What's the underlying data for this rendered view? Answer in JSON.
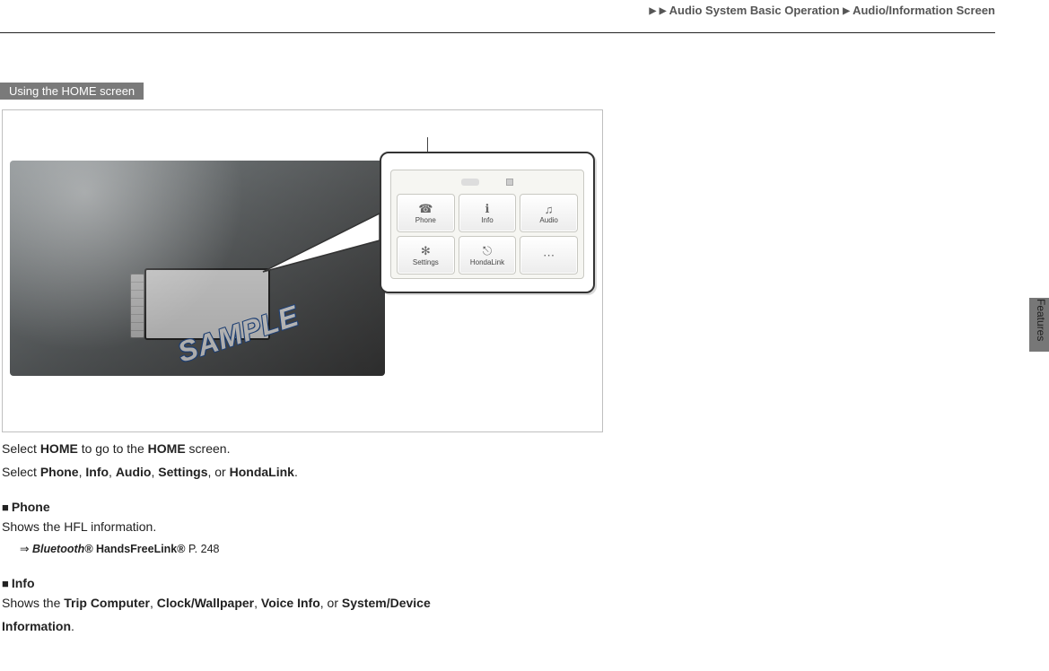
{
  "breadcrumb": {
    "section1": "Audio System Basic Operation",
    "section2": "Audio/Information Screen"
  },
  "section_tab": "Using the HOME screen",
  "side_label": "Features",
  "figure": {
    "sample_stamp": "SAMPLE",
    "tiles": {
      "t1": {
        "label": "Phone"
      },
      "t2": {
        "label": "Info"
      },
      "t3": {
        "label": "Audio"
      },
      "t4": {
        "label": "Settings"
      },
      "t5": {
        "label": "HondaLink"
      },
      "t6": {
        "label": ""
      }
    }
  },
  "body": {
    "line1_a": "Select ",
    "line1_b": "HOME",
    "line1_c": " to go to the ",
    "line1_d": "HOME",
    "line1_e": " screen.",
    "line2_a": "Select ",
    "line2_phone": "Phone",
    "line2_sep1": ", ",
    "line2_info": "Info",
    "line2_sep2": ", ",
    "line2_audio": "Audio",
    "line2_sep3": ", ",
    "line2_settings": "Settings",
    "line2_sep4": ", or ",
    "line2_hondalink": "HondaLink",
    "line2_end": ".",
    "phone_head": "Phone",
    "phone_text_a": "Shows the HFL information.",
    "phone_ref_a": "Bluetooth®",
    "phone_ref_b": " HandsFreeLink®",
    "phone_ref_page": " P. 248",
    "info_head": "Info",
    "info_text_a": "Shows the ",
    "info_trip": "Trip Computer",
    "info_sep1": ", ",
    "info_clockwall": "Clock/Wallpaper",
    "info_sep2": ", ",
    "info_voice": "Voice Info",
    "info_sep3": ", or ",
    "info_sys": "System/Device",
    "info_line2": "Information",
    "info_end": "."
  }
}
